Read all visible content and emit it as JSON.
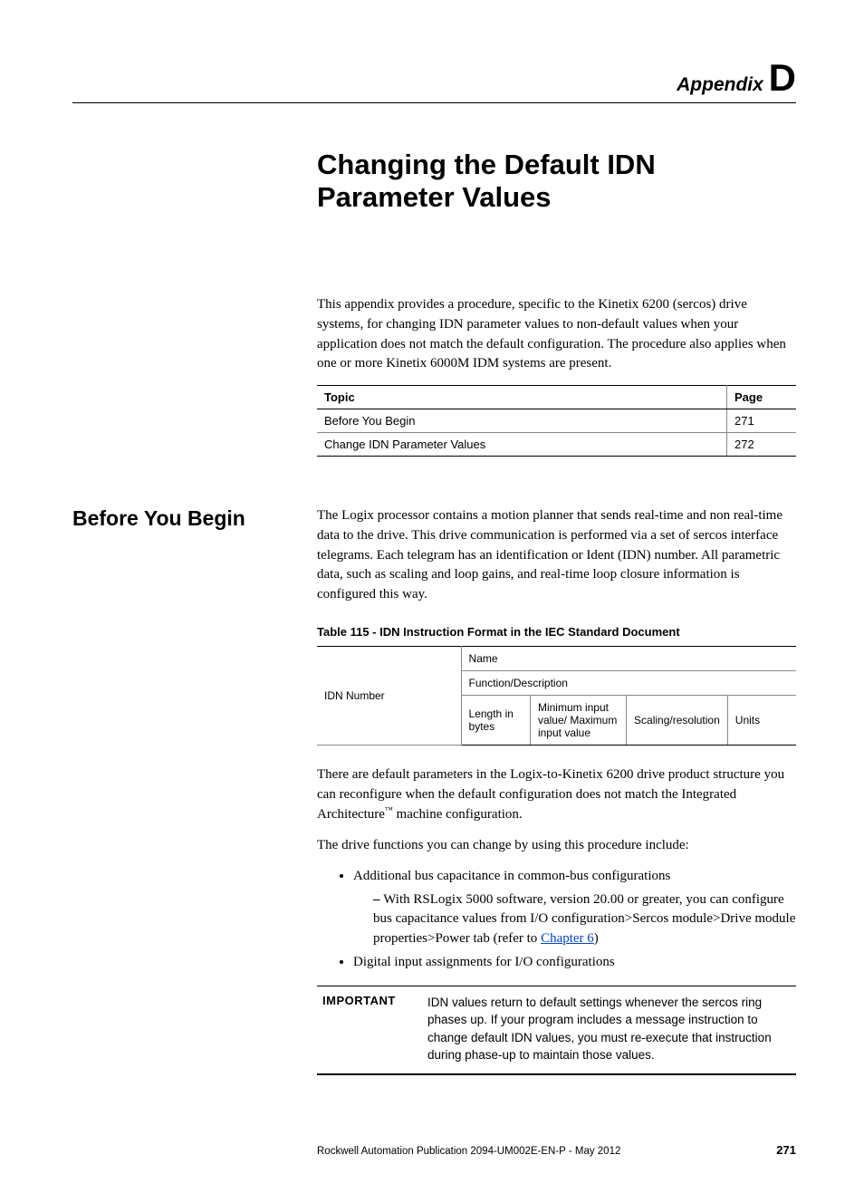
{
  "header": {
    "appendix_label": "Appendix",
    "appendix_letter": "D"
  },
  "title": "Changing the Default IDN Parameter Values",
  "intro": "This appendix provides a procedure, specific to the Kinetix 6200 (sercos) drive systems, for changing IDN parameter values to non-default values when your application does not match the default configuration. The procedure also applies when one or more Kinetix 6000M IDM systems are present.",
  "topic_table": {
    "headers": {
      "topic": "Topic",
      "page": "Page"
    },
    "rows": [
      {
        "topic": "Before You Begin",
        "page": "271"
      },
      {
        "topic": "Change IDN Parameter Values",
        "page": "272"
      }
    ]
  },
  "section": {
    "heading": "Before You Begin",
    "p1": "The Logix processor contains a motion planner that sends real-time and non real-time data to the drive. This drive communication is performed via a set of sercos interface telegrams. Each telegram has an identification or Ident (IDN) number. All parametric data, such as scaling and loop gains, and real-time loop closure information is configured this way.",
    "table_caption": "Table 115 - IDN Instruction Format in the IEC Standard Document",
    "idn_table": {
      "left": "IDN Number",
      "r1": "Name",
      "r2": "Function/Description",
      "r3c1": "Length in bytes",
      "r3c2": "Minimum input value/ Maximum input value",
      "r3c3": "Scaling/resolution",
      "r3c4": "Units"
    },
    "p2_prefix": "There are default parameters in the Logix-to-Kinetix 6200 drive product structure you can reconfigure when the default configuration does not match the Integrated Architecture",
    "p2_suffix": " machine configuration.",
    "p3": "The drive functions you can change by using this procedure include:",
    "bullets": {
      "b1": "Additional bus capacitance in common-bus configurations",
      "b1_sub_prefix": "With RSLogix 5000 software, version 20.00 or greater, you can configure bus capacitance values from I/O configuration>Sercos module>Drive module properties>Power tab (refer to ",
      "b1_sub_link": "Chapter 6",
      "b1_sub_suffix": ")",
      "b2": "Digital input assignments for I/O configurations"
    },
    "important": {
      "label": "IMPORTANT",
      "text": "IDN values return to default settings whenever the sercos ring phases up. If your program includes a message instruction to change default IDN values, you must re-execute that instruction during phase-up to maintain those values."
    }
  },
  "footer": {
    "pub": "Rockwell Automation Publication 2094-UM002E-EN-P - May 2012",
    "page": "271"
  }
}
